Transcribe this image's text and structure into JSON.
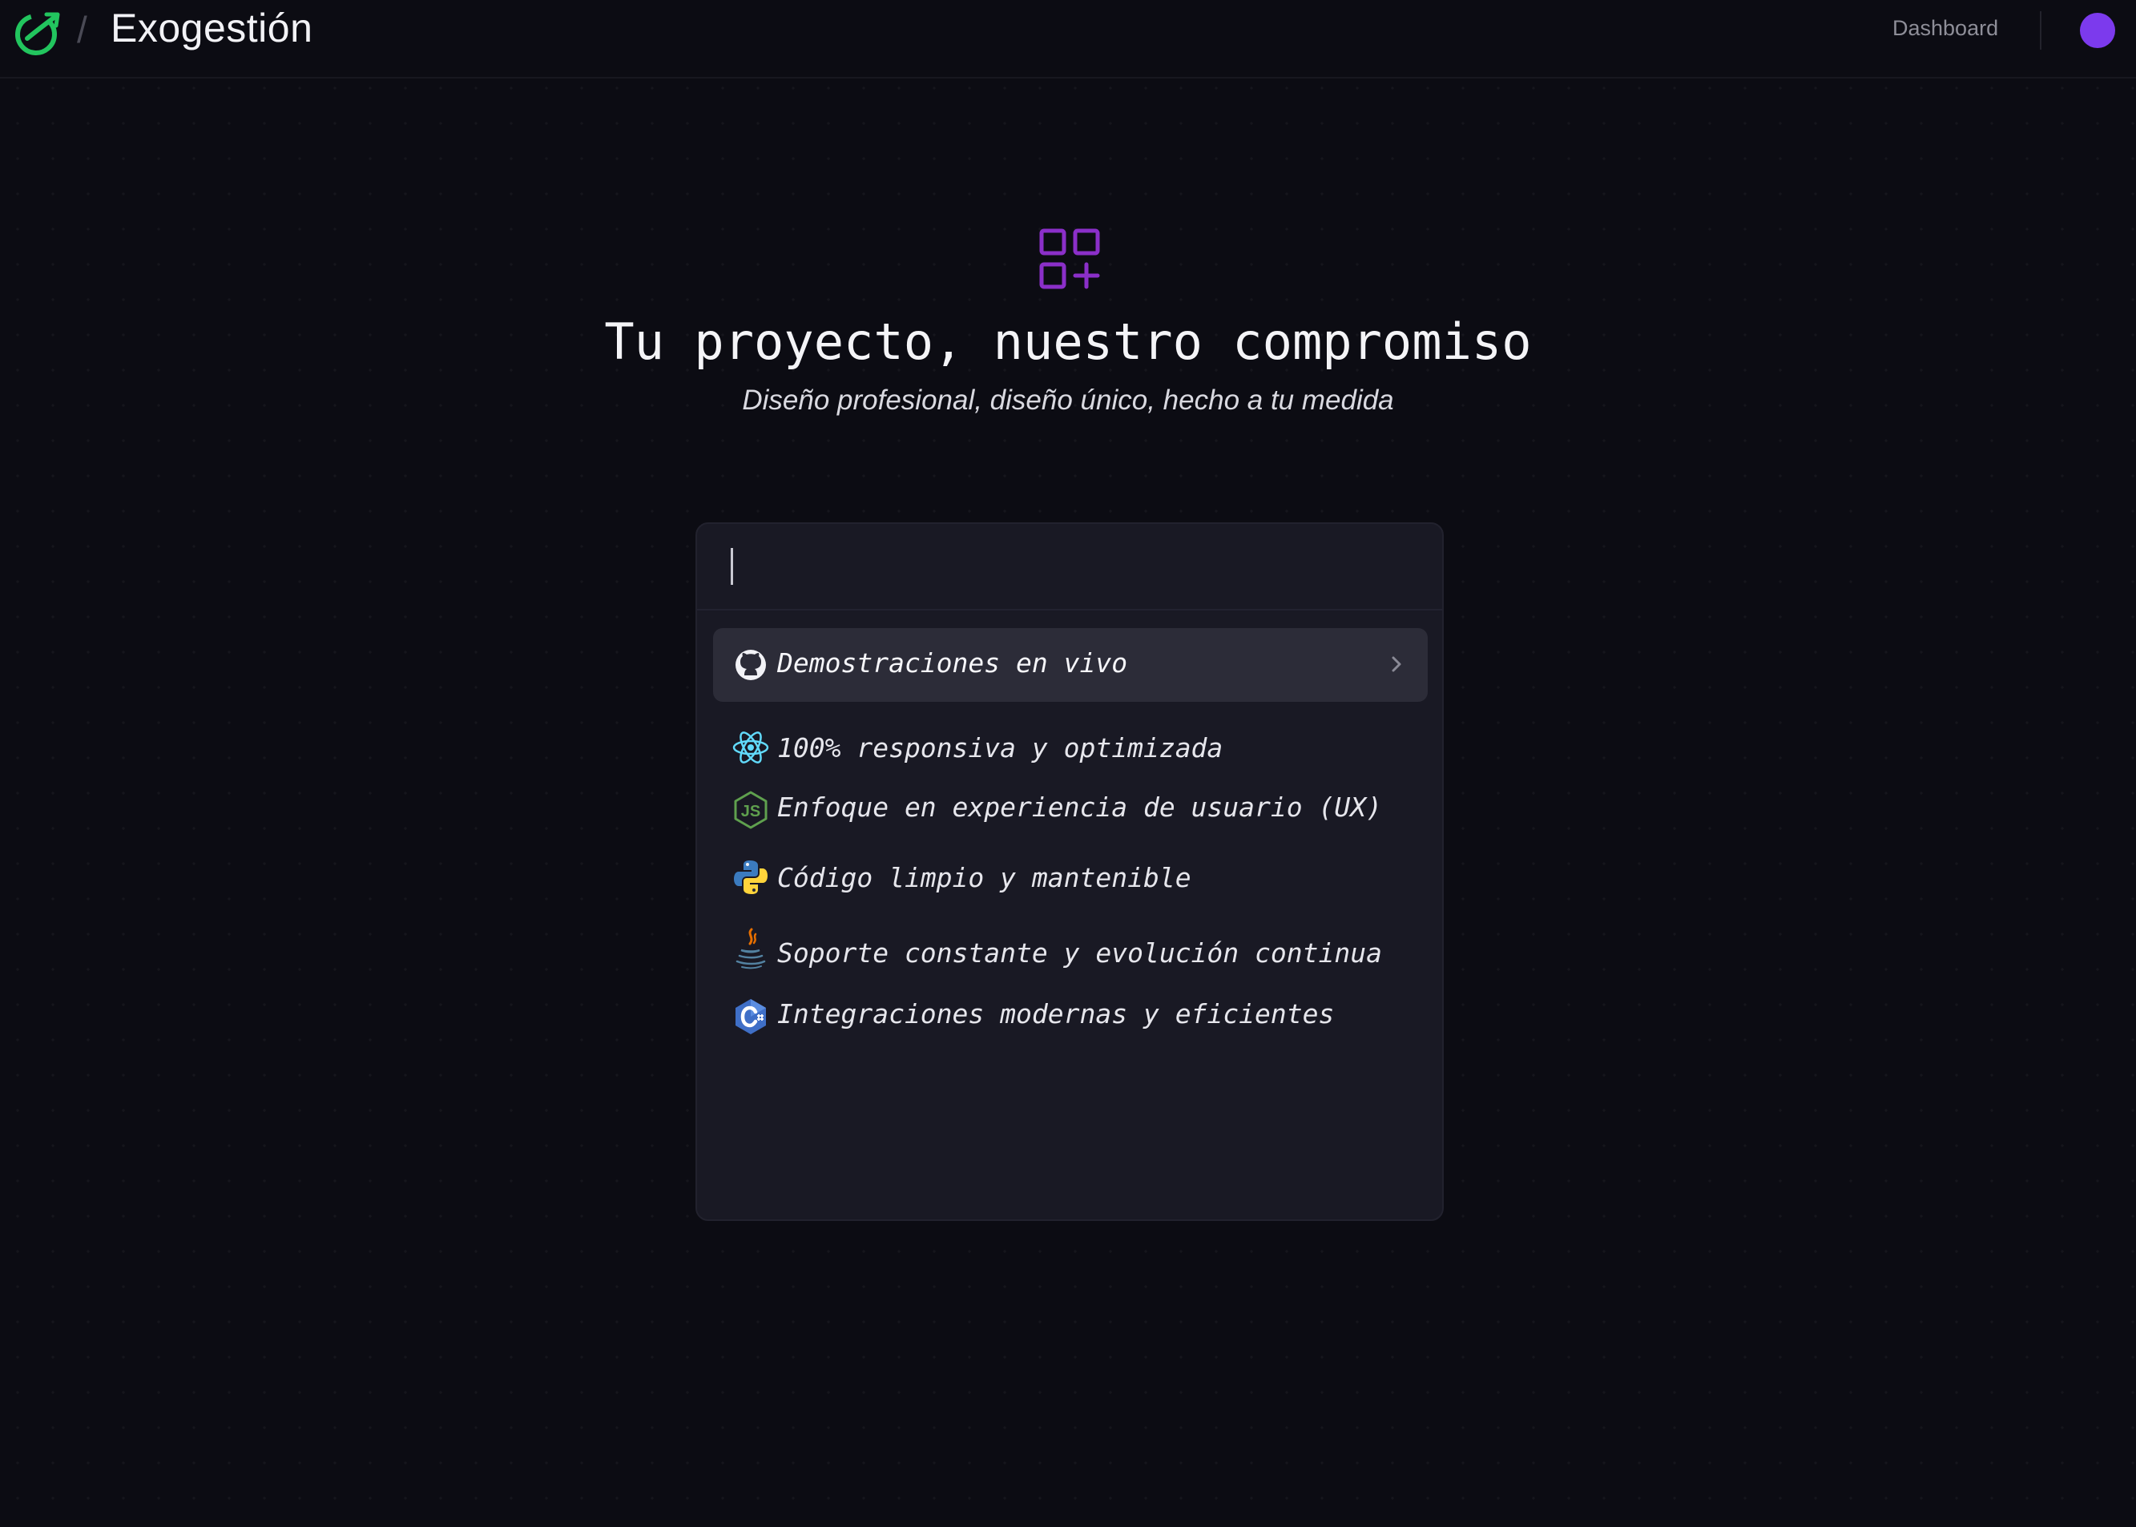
{
  "header": {
    "brand": "Exogestión",
    "separator": "/",
    "nav_link": "Dashboard",
    "logo_icon": "refresh-orbit-icon",
    "accent_color": "#22c55e",
    "avatar_color": "#7c3aed"
  },
  "hero": {
    "icon": "apps-grid-plus-icon",
    "icon_color": "#8b2fc9",
    "title": "Tu proyecto, nuestro compromiso",
    "subtitle": "Diseño profesional, diseño único, hecho a tu medida"
  },
  "command_panel": {
    "search_value": "",
    "items": [
      {
        "label": "Demostraciones en vivo",
        "icon": "github-icon",
        "active": true
      },
      {
        "label": "100% responsiva y optimizada",
        "icon": "react-icon",
        "active": false
      },
      {
        "label": "Enfoque en experiencia de usuario (UX)",
        "icon": "nodejs-icon",
        "active": false
      },
      {
        "label": "Código limpio y mantenible",
        "icon": "python-icon",
        "active": false
      },
      {
        "label": "Soporte constante y evolución continua",
        "icon": "java-icon",
        "active": false
      },
      {
        "label": "Integraciones modernas y eficientes",
        "icon": "csharp-icon",
        "active": false
      }
    ]
  }
}
